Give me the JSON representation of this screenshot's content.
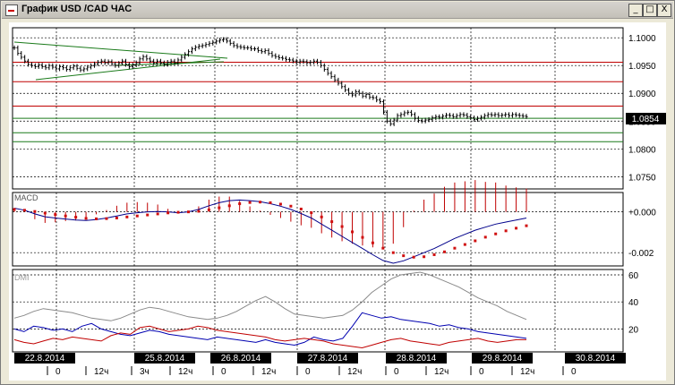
{
  "window": {
    "title": "График USD /CAD ЧАС",
    "min_glyph": "_",
    "max_glyph": "□",
    "close_glyph": "X",
    "icon": "chart-window-icon"
  },
  "chart_data": {
    "type": "line",
    "price": {
      "axis_ticks": [
        "1.1000",
        "1.0950",
        "1.0900",
        "1.0850",
        "1.0800",
        "1.0750"
      ],
      "ylim": [
        1.0728,
        1.1018
      ],
      "current_price": "1.0854",
      "hlines_red": [
        1.0956,
        1.0921,
        1.0877
      ],
      "hlines_green": [
        1.0855,
        1.0829,
        1.0813
      ],
      "closes": [
        1.0982,
        1.0972,
        1.0965,
        1.0958,
        1.0952,
        1.095,
        1.0948,
        1.0951,
        1.0948,
        1.0946,
        1.095,
        1.0947,
        1.0944,
        1.0948,
        1.0946,
        1.0943,
        1.0946,
        1.0949,
        1.0945,
        1.0942,
        1.0944,
        1.0947,
        1.095,
        1.0953,
        1.0956,
        1.0958,
        1.0955,
        1.0957,
        1.0953,
        1.095,
        1.0954,
        1.0958,
        1.0952,
        1.0948,
        1.0951,
        1.0955,
        1.0962,
        1.0966,
        1.0962,
        1.0958,
        1.0955,
        1.0958,
        1.0955,
        1.0952,
        1.0956,
        1.0958,
        1.0955,
        1.096,
        1.0965,
        1.097,
        1.0975,
        1.098,
        1.0983,
        1.0985,
        1.0986,
        1.0988,
        1.099,
        1.0992,
        1.0994,
        1.0996,
        1.0997,
        1.0994,
        1.099,
        1.0986,
        1.0984,
        1.0983,
        1.0982,
        1.0982,
        1.098,
        1.098,
        1.0977,
        1.0975,
        1.0977,
        1.0972,
        1.0968,
        1.0966,
        1.0964,
        1.0963,
        1.0961,
        1.096,
        1.0958,
        1.0956,
        1.0958,
        1.0957,
        1.0955,
        1.0956,
        1.0958,
        1.0956,
        1.095,
        1.0943,
        1.0936,
        1.093,
        1.0924,
        1.0918,
        1.0912,
        1.0906,
        1.09,
        1.0897,
        1.0903,
        1.09,
        1.0895,
        1.0898,
        1.0893,
        1.0892,
        1.0888,
        1.0885,
        1.0866,
        1.085,
        1.0845,
        1.0852,
        1.086,
        1.0862,
        1.0865,
        1.0866,
        1.0862,
        1.0855,
        1.0851,
        1.085,
        1.0852,
        1.0853,
        1.0856,
        1.0858,
        1.0857,
        1.0859,
        1.0861,
        1.086,
        1.0858,
        1.086,
        1.0862,
        1.0861,
        1.0858,
        1.0856,
        1.0853,
        1.0855,
        1.0857,
        1.086,
        1.0862,
        1.0861,
        1.0862,
        1.086,
        1.0861,
        1.0862,
        1.086,
        1.0862,
        1.0861,
        1.086,
        1.0859,
        1.0858
      ]
    },
    "macd": {
      "label": "MACD",
      "axis_ticks": [
        "+0.000",
        "-0.002"
      ],
      "ylim": [
        -0.00265,
        0.00095
      ],
      "line": [
        0.00018,
        8e-05,
        -0.0001,
        -0.00024,
        -0.0003,
        -0.00035,
        -0.0004,
        -0.00042,
        -0.00038,
        -0.0003,
        -0.0002,
        -0.0001,
        -4e-05,
        0.0,
        2e-05,
        0.0,
        -4e-05,
        0.0,
        0.00012,
        0.0003,
        0.00045,
        0.00055,
        0.00058,
        0.00055,
        0.0005,
        0.0004,
        0.00028,
        0.00012,
        -8e-05,
        -0.0003,
        -0.0006,
        -0.0009,
        -0.0012,
        -0.0015,
        -0.0018,
        -0.0021,
        -0.00238,
        -0.00252,
        -0.0024,
        -0.0022,
        -0.002,
        -0.0018,
        -0.00155,
        -0.0013,
        -0.0011,
        -0.0009,
        -0.00075,
        -0.0006,
        -0.0005,
        -0.0004,
        -0.0003
      ],
      "signal": [
        0.00012,
        8e-05,
        2e-05,
        -6e-05,
        -0.00013,
        -0.0002,
        -0.00026,
        -0.00032,
        -0.00034,
        -0.00033,
        -0.0003,
        -0.00025,
        -0.0002,
        -0.00015,
        -0.0001,
        -5e-05,
        -2e-05,
        0.0,
        3e-05,
        0.0001,
        0.0002,
        0.0003,
        0.0004,
        0.00046,
        0.00048,
        0.00045,
        0.00038,
        0.00028,
        0.00014,
        -4e-05,
        -0.00025,
        -0.00048,
        -0.00072,
        -0.00098,
        -0.00125,
        -0.00152,
        -0.00178,
        -0.002,
        -0.00215,
        -0.00222,
        -0.0022,
        -0.0021,
        -0.00196,
        -0.00178,
        -0.0016,
        -0.00142,
        -0.00124,
        -0.00108,
        -0.00093,
        -0.0008,
        -0.00068
      ]
    },
    "dmi": {
      "label": "DMI",
      "axis_ticks": [
        "60",
        "40",
        "20"
      ],
      "ylim": [
        3,
        64
      ],
      "adx": [
        28,
        30,
        33,
        35,
        34,
        33,
        32,
        30,
        28,
        27,
        26,
        28,
        31,
        34,
        36,
        35,
        33,
        31,
        29,
        28,
        27,
        28,
        30,
        33,
        37,
        41,
        44,
        40,
        35,
        31,
        30,
        29,
        28,
        29,
        30,
        34,
        40,
        47,
        52,
        57,
        60,
        61,
        62,
        60,
        57,
        54,
        51,
        47,
        43,
        40,
        37,
        33,
        30,
        27
      ],
      "plus_di": [
        20,
        18,
        22,
        21,
        19,
        20,
        18,
        22,
        24,
        20,
        18,
        16,
        15,
        17,
        19,
        18,
        16,
        15,
        14,
        13,
        12,
        14,
        13,
        12,
        11,
        10,
        12,
        10,
        9,
        8,
        10,
        14,
        12,
        11,
        13,
        22,
        32,
        30,
        28,
        29,
        27,
        26,
        25,
        24,
        22,
        23,
        21,
        20,
        18,
        17,
        16,
        15,
        14,
        13
      ],
      "minus_di": [
        12,
        10,
        9,
        11,
        13,
        12,
        14,
        13,
        12,
        11,
        15,
        17,
        16,
        21,
        22,
        20,
        18,
        19,
        20,
        22,
        21,
        19,
        18,
        17,
        16,
        15,
        14,
        12,
        11,
        12,
        13,
        12,
        11,
        9,
        8,
        7,
        6,
        8,
        10,
        12,
        13,
        11,
        10,
        9,
        8,
        10,
        11,
        12,
        13,
        11,
        10,
        11,
        12,
        12
      ]
    },
    "time_axis": {
      "dates": [
        "22.8.2014",
        "25.8.2014",
        "26.8.2014",
        "27.8.2014",
        "28.8.2014",
        "29.8.2014",
        "30.8.2014"
      ],
      "hour_labels": [
        "0",
        "12ч",
        "3ч",
        "12ч",
        "0",
        "12ч",
        "0",
        "12ч",
        "0",
        "12ч",
        "0",
        "12ч",
        "0"
      ]
    }
  }
}
